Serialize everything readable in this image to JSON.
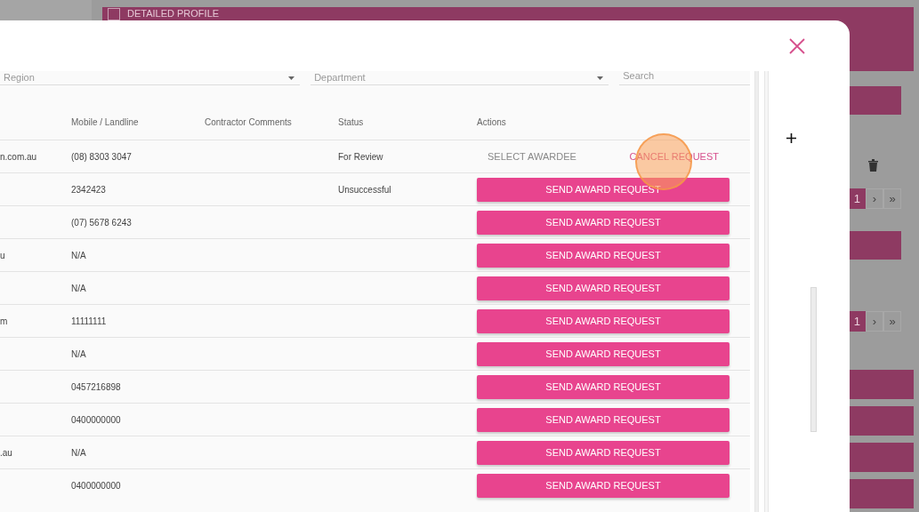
{
  "background": {
    "section_title": "DETAILED PROFILE",
    "pagers": [
      {
        "page": "1",
        "next": "›",
        "last": "»"
      },
      {
        "page": "1",
        "next": "›",
        "last": "»"
      }
    ]
  },
  "modal": {
    "filters": [
      {
        "kind": "select",
        "placeholder": "Region"
      },
      {
        "kind": "select",
        "placeholder": "Department"
      },
      {
        "kind": "search",
        "placeholder": "Search"
      }
    ],
    "table": {
      "columns": [
        "",
        "Mobile / Landline",
        "Contractor Comments",
        "Status",
        "Actions"
      ],
      "rows": [
        {
          "column_1": "n.com.au",
          "phone": "(08) 8303 3047",
          "status": "For Review",
          "actions": [
            {
              "kind": "text",
              "label": "SELECT AWARDEE"
            },
            {
              "kind": "text-accent",
              "label": "CANCEL REQUEST"
            }
          ]
        },
        {
          "column_1": "",
          "phone": "2342423",
          "status": "Unsuccessful",
          "actions": [
            {
              "kind": "primary",
              "label": "SEND AWARD REQUEST"
            }
          ]
        },
        {
          "column_1": "",
          "phone": "(07) 5678 6243",
          "status": "",
          "actions": [
            {
              "kind": "primary",
              "label": "SEND AWARD REQUEST"
            }
          ]
        },
        {
          "column_1": "u",
          "phone": "N/A",
          "status": "",
          "actions": [
            {
              "kind": "primary",
              "label": "SEND AWARD REQUEST"
            }
          ]
        },
        {
          "column_1": "",
          "phone": "N/A",
          "status": "",
          "actions": [
            {
              "kind": "primary",
              "label": "SEND AWARD REQUEST"
            }
          ]
        },
        {
          "column_1": "m",
          "phone": "11111111",
          "status": "",
          "actions": [
            {
              "kind": "primary",
              "label": "SEND AWARD REQUEST"
            }
          ]
        },
        {
          "column_1": "",
          "phone": "N/A",
          "status": "",
          "actions": [
            {
              "kind": "primary",
              "label": "SEND AWARD REQUEST"
            }
          ]
        },
        {
          "column_1": "",
          "phone": "0457216898",
          "status": "",
          "actions": [
            {
              "kind": "primary",
              "label": "SEND AWARD REQUEST"
            }
          ]
        },
        {
          "column_1": "",
          "phone": "0400000000",
          "status": "",
          "actions": [
            {
              "kind": "primary",
              "label": "SEND AWARD REQUEST"
            }
          ]
        },
        {
          "column_1": ".au",
          "phone": "N/A",
          "status": "",
          "actions": [
            {
              "kind": "primary",
              "label": "SEND AWARD REQUEST"
            }
          ]
        },
        {
          "column_1": "",
          "phone": "0400000000",
          "status": "",
          "actions": [
            {
              "kind": "primary",
              "label": "SEND AWARD REQUEST"
            }
          ]
        }
      ]
    }
  }
}
